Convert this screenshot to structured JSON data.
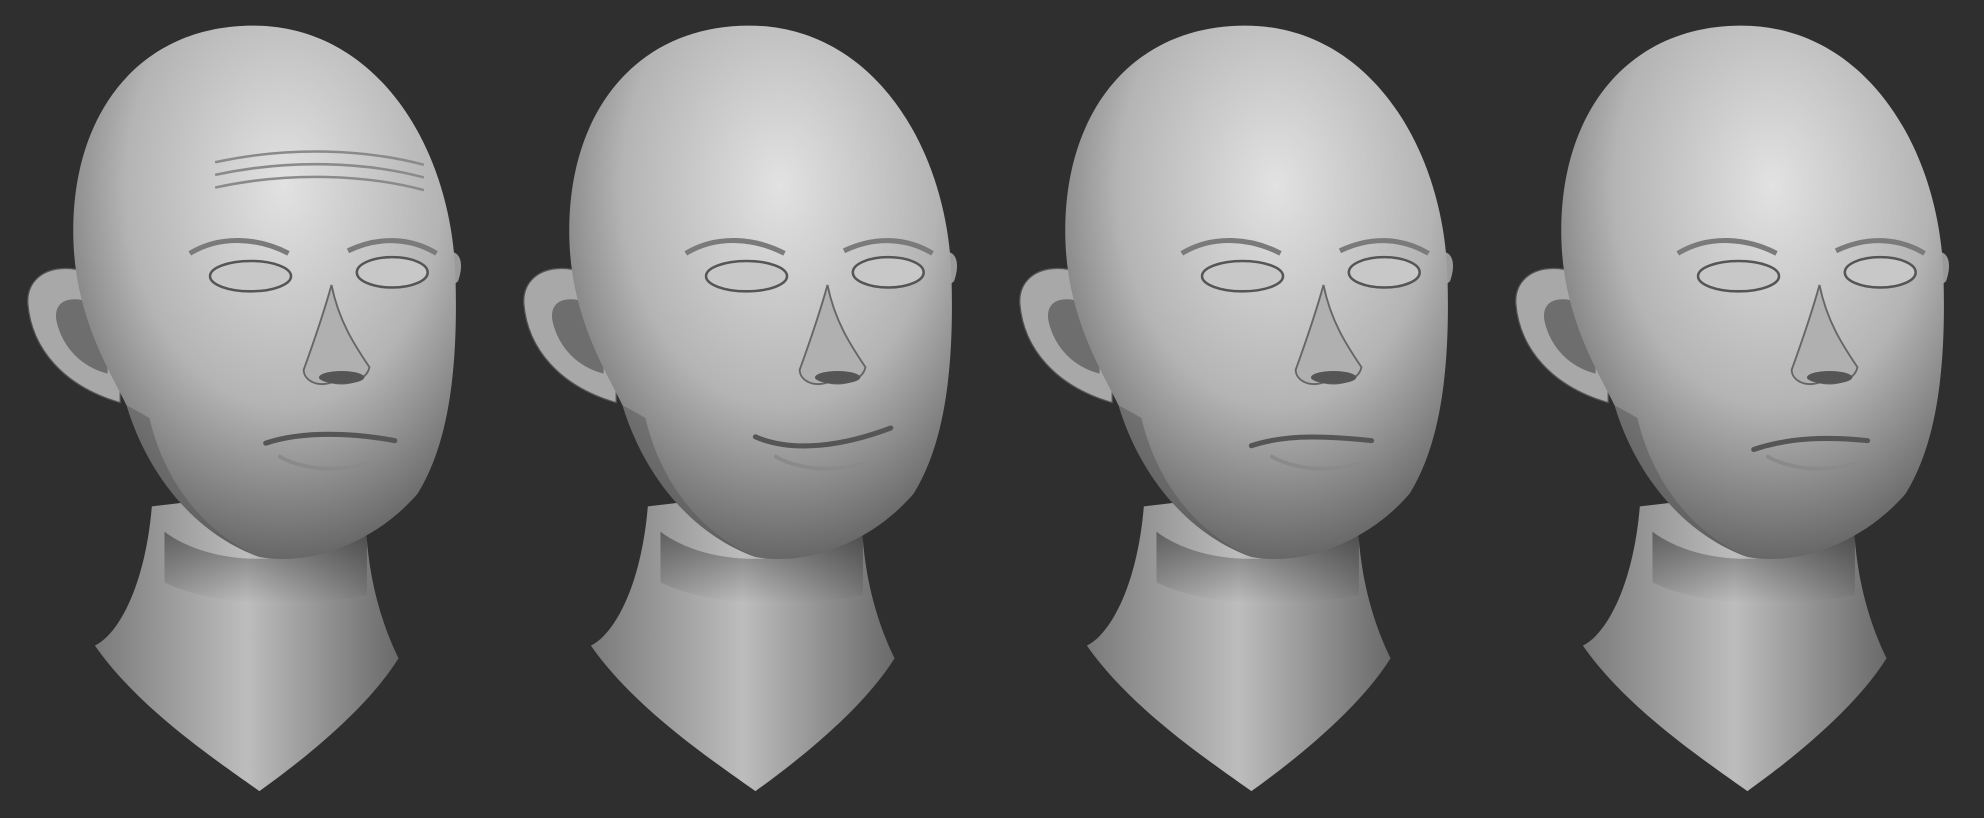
{
  "colors": {
    "background": "#2f2f2f",
    "clay_light": "#d8d8d8",
    "clay_mid": "#9a9a9a",
    "clay_dark": "#4a4a4a"
  },
  "heads": [
    {
      "expression": "raised-brows"
    },
    {
      "expression": "smirk"
    },
    {
      "expression": "pursed"
    },
    {
      "expression": "neutral"
    }
  ]
}
